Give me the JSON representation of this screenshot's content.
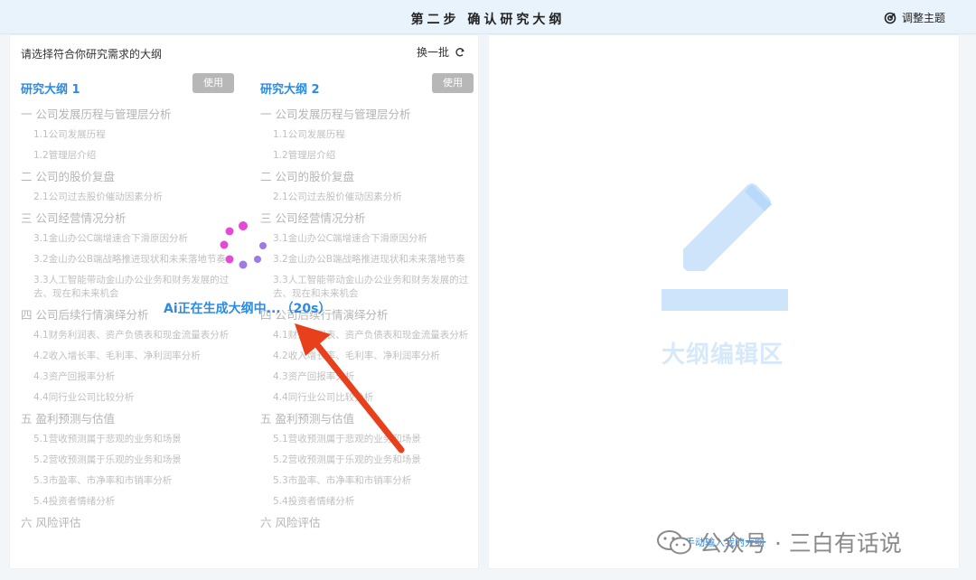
{
  "header": {
    "title": "第二步 确认研究大纲",
    "theme_button": "调整主题"
  },
  "left": {
    "prompt": "请选择符合你研究需求的大纲",
    "refresh_label": "换一批",
    "use_label": "使用",
    "outlines": [
      {
        "title": "研究大纲 1",
        "sections": [
          {
            "title": "一 公司发展历程与管理层分析",
            "subs": [
              "1.1公司发展历程",
              "1.2管理层介绍"
            ]
          },
          {
            "title": "二 公司的股价复盘",
            "subs": [
              "2.1公司过去股价催动因素分析"
            ]
          },
          {
            "title": "三 公司经营情况分析",
            "subs": [
              "3.1金山办公C端增速合下滑原因分析",
              "3.2金山办公B端战略推进现状和未来落地节奏",
              "3.3人工智能带动金山办公业务和财务发展的过去、现在和未来机会"
            ]
          },
          {
            "title": "四 公司后续行情演绎分析",
            "subs": [
              "4.1财务利润表、资产负债表和现金流量表分析",
              "4.2收入增长率、毛利率、净利润率分析",
              "4.3资产回报率分析",
              "4.4同行业公司比较分析"
            ]
          },
          {
            "title": "五 盈利预测与估值",
            "subs": [
              "5.1营收预测属于悲观的业务和场景",
              "5.2营收预测属于乐观的业务和场景",
              "5.3市盈率、市净率和市销率分析",
              "5.4投资者情绪分析"
            ]
          },
          {
            "title": "六 风险评估",
            "subs": []
          }
        ]
      },
      {
        "title": "研究大纲 2",
        "sections": [
          {
            "title": "一 公司发展历程与管理层分析",
            "subs": [
              "1.1公司发展历程",
              "1.2管理层介绍"
            ]
          },
          {
            "title": "二 公司的股价复盘",
            "subs": [
              "2.1公司过去股价催动因素分析"
            ]
          },
          {
            "title": "三 公司经营情况分析",
            "subs": [
              "3.1金山办公C端增速合下滑原因分析",
              "3.2金山办公B端战略推进现状和未来落地节奏",
              "3.3人工智能带动金山办公业务和财务发展的过去、现在和未来机会"
            ]
          },
          {
            "title": "四 公司后续行情演绎分析",
            "subs": [
              "4.1财务利润表、资产负债表和现金流量表分析",
              "4.2收入增长率、毛利率、净利润率分析",
              "4.3资产回报率分析",
              "4.4同行业公司比较分析"
            ]
          },
          {
            "title": "五 盈利预测与估值",
            "subs": [
              "5.1营收预测属于悲观的业务和场景",
              "5.2营收预测属于乐观的业务和场景",
              "5.3市盈率、市净率和市销率分析",
              "5.4投资者情绪分析"
            ]
          },
          {
            "title": "六 风险评估",
            "subs": []
          }
        ]
      }
    ]
  },
  "loading": {
    "text": "Ai正在生成大纲中...（20s）"
  },
  "right": {
    "edit_area_label": "大纲编辑区",
    "manual_link": "手动输入我的大纲"
  },
  "watermark": {
    "text": "公众号 · 三白有话说"
  },
  "colors": {
    "accent": "#2b8be6",
    "arrow": "#e8401c",
    "spinner_pink": "#e34ad6",
    "spinner_purple": "#9b7be6"
  }
}
